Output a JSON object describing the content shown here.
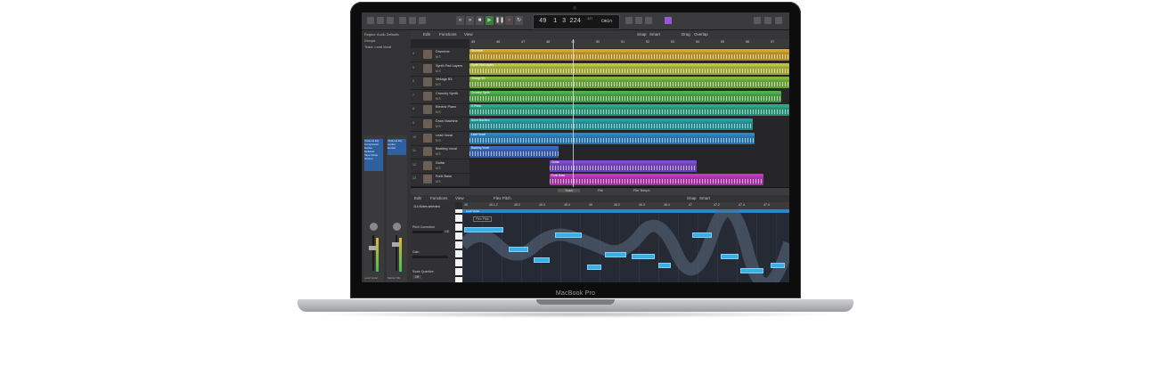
{
  "device": {
    "label": "MacBook Pro"
  },
  "colors": {
    "bezel": "#0d0d0e",
    "accent_play": "#45c24b",
    "record": "#e0403a",
    "flex_note": "#3aaee6"
  },
  "transport": {
    "bar": "49",
    "beat": "1",
    "tempo": "3 224",
    "time_sig": "127",
    "key": "Cmin"
  },
  "inspector": {
    "region_label": "Region: Audio Defaults",
    "groups_label": "Groups",
    "track_label": "Track: Lead Vocal",
    "strip_left": "Lead Vocal",
    "strip_right": "Master Mix",
    "eq_left": [
      "Channel EQ",
      "Compressor",
      "Exciter",
      "DeEsser",
      "Tape Delay",
      "Chorus"
    ],
    "eq_right": [
      "Channel EQ",
      "Limiter",
      "Exciter"
    ]
  },
  "menu": {
    "edit": "Edit",
    "functions": "Functions",
    "view": "View",
    "snap": "Snap",
    "smart": "Smart",
    "drag": "Drag",
    "overlap": "Overlap"
  },
  "ruler": [
    "45",
    "46",
    "47",
    "48",
    "49",
    "50",
    "51",
    "52",
    "53",
    "54",
    "55",
    "56",
    "57"
  ],
  "tracks": [
    {
      "num": "4",
      "name": "Drummer",
      "region": "Drummer",
      "color": "#d4a82a",
      "start": 0,
      "width": 359
    },
    {
      "num": "5",
      "name": "Synth Pad Layers",
      "region": "Synth Pad Layers",
      "color": "#b8c43a",
      "start": 0,
      "width": 359
    },
    {
      "num": "6",
      "name": "Vintage B3",
      "region": "Vintage B3",
      "color": "#7bb840",
      "start": 0,
      "width": 359
    },
    {
      "num": "7",
      "name": "Crunchy Synth",
      "region": "Crunchy Synth",
      "color": "#4fb04a",
      "start": 0,
      "width": 350
    },
    {
      "num": "8",
      "name": "Electric Piano",
      "region": "E.Piano",
      "color": "#2aa888",
      "start": 0,
      "width": 359
    },
    {
      "num": "9",
      "name": "Drum Machine",
      "region": "Drum Machine",
      "color": "#23a2a6",
      "start": 0,
      "width": 318
    },
    {
      "num": "10",
      "name": "Lead Vocal",
      "region": "Lead Vocal",
      "color": "#2a86c8",
      "start": 0,
      "width": 320
    },
    {
      "num": "11",
      "name": "Backing Vocal",
      "region": "Backing Vocal",
      "color": "#3a6ac4",
      "start": 0,
      "width": 100
    },
    {
      "num": "12",
      "name": "Guitar",
      "region": "Guitar",
      "color": "#7e4bd1",
      "start": 90,
      "width": 165
    },
    {
      "num": "13",
      "name": "Funk Bass",
      "region": "Funk Bass",
      "color": "#c238c0",
      "start": 90,
      "width": 240
    }
  ],
  "editor": {
    "tabs": [
      "Track",
      "File",
      "File Tempo"
    ],
    "flex_mode": "Flex Pitch",
    "notes_selected": "114 Notes selected",
    "pitch_correction": "Pitch Correction",
    "gain": "Gain",
    "scale_quantize": "Scale Quantize",
    "off": "Off",
    "value": "100",
    "region_label": "Lead Vocal",
    "ruler": [
      "45",
      "45.1.2",
      "45.2",
      "45.3",
      "45.4",
      "46",
      "46.2",
      "46.3",
      "46.4",
      "47",
      "47.2",
      "47.3",
      "47.4"
    ],
    "tooltip": "Flex Pitch"
  }
}
